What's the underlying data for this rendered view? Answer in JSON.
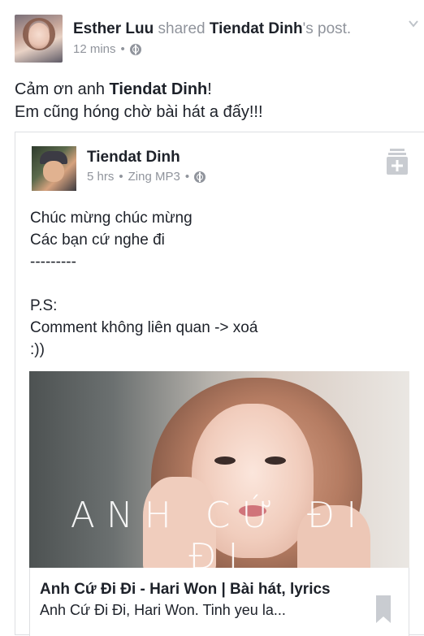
{
  "post": {
    "author": "Esther Luu",
    "action_text": " shared ",
    "shared_from": "Tiendat Dinh",
    "suffix": "'s post.",
    "time": "12 mins",
    "dot": "•",
    "status_line1_prefix": "Cảm ơn anh ",
    "status_line1_name": "Tiendat Dinh",
    "status_line1_suffix": "!",
    "status_line2": "Em cũng hóng chờ bài hát a đấy!!!"
  },
  "shared_post": {
    "author": "Tiendat Dinh",
    "time": "5 hrs",
    "source": "Zing MP3",
    "dot": "•",
    "body": "Chúc mừng chúc mừng\nCác bạn cứ nghe đi\n---------\n\nP.S:\nComment không liên quan -> xoá\n:))",
    "link": {
      "image_overlay_text": "ANH CỨ ĐI ĐI",
      "title": "Anh Cứ Đi Đi - Hari Won | Bài hát, lyrics",
      "description": "Anh Cứ Đi Đi, Hari Won. Tinh yeu la..."
    }
  },
  "icons": {
    "visibility": "globe-icon",
    "menu": "chevron-down-icon",
    "save": "save-plus-icon",
    "bookmark": "bookmark-icon"
  },
  "colors": {
    "text": "#1d2129",
    "muted": "#90949c",
    "border": "#dddfe2"
  }
}
